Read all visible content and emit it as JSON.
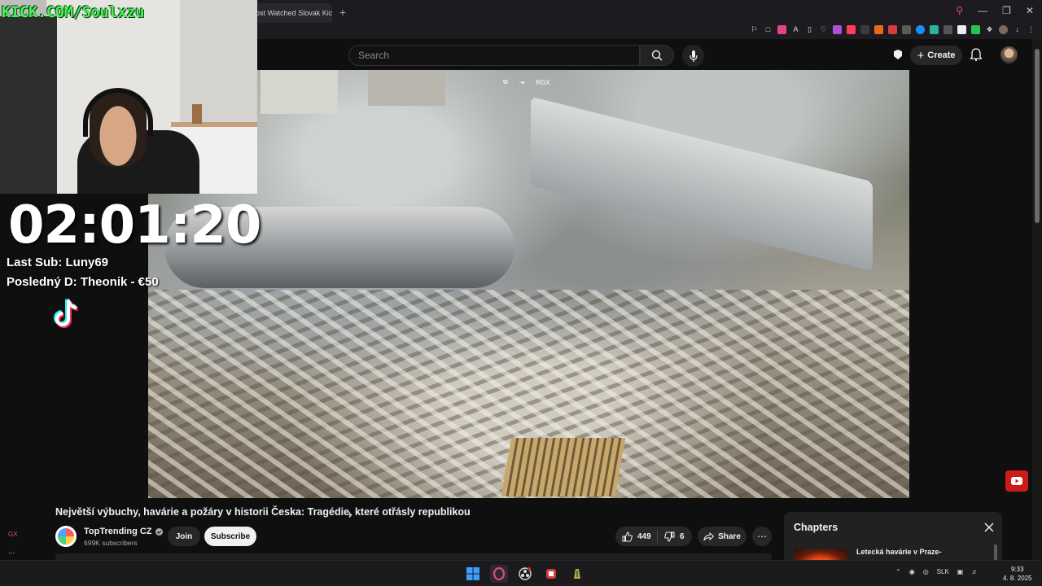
{
  "browser": {
    "tab_title": "ost Watched Slovak Kic",
    "new_tab_icon": "plus-icon"
  },
  "masthead": {
    "search_placeholder": "Search",
    "create_label": "Create"
  },
  "video": {
    "overlay_label": "RGX"
  },
  "stream_overlay": {
    "kick_url": "KICK.COM/Soulxzu",
    "timer": "02:01:20",
    "last_sub": "Last Sub: Luny69",
    "last_donation": "Posledný D: Theonik - €50",
    "sidebar_tag": "GX",
    "sidebar_more": "..."
  },
  "watch": {
    "title": "Největší výbuchy, havárie a požáry v historii Česka: Tragédie, které otřásly republikou",
    "channel_name": "TopTrending CZ",
    "subscribers": "699K subscribers",
    "join_label": "Join",
    "subscribe_label": "Subscribe",
    "likes": "449",
    "dislikes": "6",
    "share_label": "Share"
  },
  "chapters": {
    "title": "Chapters",
    "first_chapter": "Letecká havárie v Praze-"
  },
  "taskbar": {
    "language": "SLK",
    "time": "9:33",
    "date": "4. 8. 2025"
  },
  "colors": {
    "kick_green": "#49f25a",
    "yt_bg": "#0f0f0f",
    "button_bg": "#272727",
    "subscribe_bg": "#f1f1f1",
    "opera_accent": "#e0478a"
  }
}
